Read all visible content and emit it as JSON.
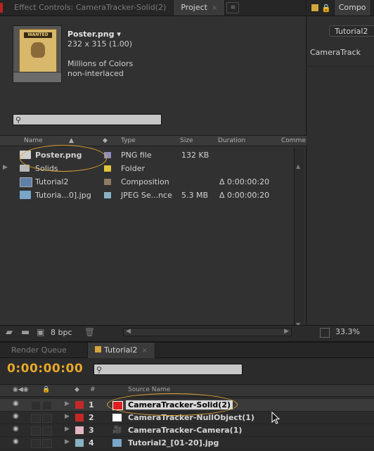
{
  "project_panel": {
    "tabs": [
      {
        "label": "Effect Controls: CameraTracker-Solid(2)",
        "active": false
      },
      {
        "label": "Project",
        "active": true,
        "close": "×"
      }
    ],
    "menu_icon": "≡",
    "selected_item": {
      "name": "Poster.png ▾",
      "dimensions": "232 x 315 (1.00)",
      "colors": "Millions of Colors",
      "interlace": "non-interlaced"
    },
    "search": {
      "placeholder": "",
      "icon": "search-icon"
    },
    "columns": [
      "Name",
      "Type",
      "Size",
      "Duration",
      "Comme"
    ],
    "items": [
      {
        "name": "Poster.png",
        "label_color": "#8f8fb8",
        "type": "PNG file",
        "size": "132 KB",
        "duration": "",
        "icon": "image-file-icon",
        "twirl": ""
      },
      {
        "name": "Solids",
        "label_color": "#e0c63a",
        "type": "Folder",
        "size": "",
        "duration": "",
        "icon": "folder-icon",
        "twirl": "▶"
      },
      {
        "name": "Tutorial2",
        "label_color": "#8e7b63",
        "type": "Composition",
        "size": "",
        "duration": "Δ 0:00:00:20",
        "icon": "composition-icon",
        "twirl": ""
      },
      {
        "name": "Tutoria...0].jpg",
        "label_color": "#89b3c2",
        "type": "JPEG Se...nce",
        "size": "5.3 MB",
        "duration": "Δ 0:00:00:20",
        "icon": "image-sequence-icon",
        "twirl": ""
      }
    ],
    "footer": {
      "bpc": "8 bpc"
    }
  },
  "comp_panel": {
    "title": "Compo",
    "tab": "Tutorial2",
    "layer_label": "CameraTrack",
    "zoom": "33.3%"
  },
  "timeline": {
    "tabs": [
      {
        "label": "Render Queue",
        "active": false
      },
      {
        "label": "Tutorial2",
        "active": true,
        "close": "×"
      }
    ],
    "timecode": "0:00:00:00",
    "columns": {
      "number": "#",
      "source_name": "Source Name"
    },
    "layers": [
      {
        "number": "1",
        "name": "CameraTracker-Solid(2)",
        "label_color": "#c62828",
        "icon_color": "#e02020",
        "selected": true
      },
      {
        "number": "2",
        "name": "CameraTracker-NullObject(1)",
        "label_color": "#c62828",
        "icon_color": "#ffffff",
        "selected": false
      },
      {
        "number": "3",
        "name": "CameraTracker-Camera(1)",
        "label_color": "#e2b6c3",
        "icon_color": "#bbbbbb",
        "selected": false
      },
      {
        "number": "4",
        "name": "Tutorial2_[01-20].jpg",
        "label_color": "#89b3c2",
        "icon_color": "#89b3c2",
        "selected": false
      }
    ]
  },
  "colors": {
    "timecode": "#e8a82a",
    "highlight_ring": "#e3a733",
    "panel_bg": "#313131"
  }
}
